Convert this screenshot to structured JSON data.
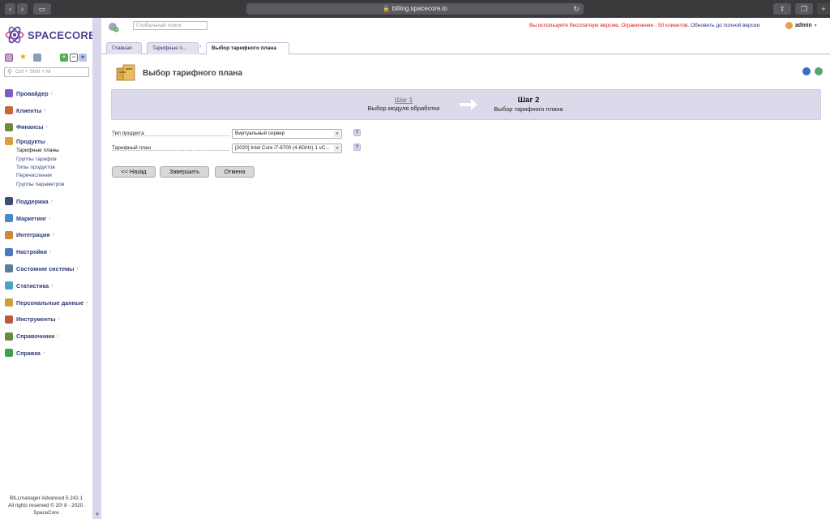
{
  "browser": {
    "url": "billing.spacecore.io"
  },
  "brand": {
    "name": "SPACECORE"
  },
  "sidebar": {
    "search_placeholder": "Ctrl + Shift + M",
    "menu": [
      {
        "label": "Провайдер",
        "icon": "provider-icon",
        "color": "#7a5cc9"
      },
      {
        "label": "Клиенты",
        "icon": "clients-icon",
        "color": "#c9643d"
      },
      {
        "label": "Финансы",
        "icon": "finance-icon",
        "color": "#6f8b3a"
      },
      {
        "label": "Продукты",
        "icon": "products-icon",
        "color": "#d9a03b",
        "sub": [
          "Тарифные планы",
          "Группы тарифов",
          "Типы продуктов",
          "Перечисления",
          "Группы параметров"
        ]
      },
      {
        "label": "Поддержка",
        "icon": "support-icon",
        "color": "#3f4b7d"
      },
      {
        "label": "Маркетинг",
        "icon": "marketing-icon",
        "color": "#4a8ac9"
      },
      {
        "label": "Интеграция",
        "icon": "integration-icon",
        "color": "#c98a3d"
      },
      {
        "label": "Настройки",
        "icon": "settings-icon",
        "color": "#4a7abf"
      },
      {
        "label": "Состояние системы",
        "icon": "system-state-icon",
        "color": "#5a7d9a"
      },
      {
        "label": "Статистика",
        "icon": "statistics-icon",
        "color": "#4aa3c9"
      },
      {
        "label": "Персональные данные",
        "icon": "personal-data-icon",
        "color": "#c9a23d"
      },
      {
        "label": "Инструменты",
        "icon": "tools-icon",
        "color": "#b85a3d"
      },
      {
        "label": "Справочники",
        "icon": "references-icon",
        "color": "#6a8a3d"
      },
      {
        "label": "Справка",
        "icon": "help-icon",
        "color": "#3da34a"
      }
    ],
    "footer": [
      "BILLmanager Advanced 5.242.1",
      "All rights reserved © 20! 8 - 2020.",
      "SpaceCore"
    ]
  },
  "top": {
    "search_placeholder": "Глобальный поиск",
    "warning": "Вы используете бесплатную версию. Ограничение - 50 клиентов.",
    "upgrade_link": "Обновить до полной версии",
    "user": "admin"
  },
  "tabs": [
    {
      "label": "Главная"
    },
    {
      "label": "Тарифные п..."
    },
    {
      "label": "Выбор тарифного плана"
    }
  ],
  "page": {
    "title": "Выбор тарифного плана",
    "step1_title": "Шаг 1",
    "step1_sub": "Выбор модуля обработки",
    "step2_title": "Шаг 2",
    "step2_sub": "Выбор тарифного плана",
    "product_type_label": "Тип продукта",
    "product_type_value": "Виртуальный сервер",
    "plan_label": "Тарифный план",
    "plan_value": "[2020] Intel Core i7-8700 (4.6GHz) 1 vC...",
    "back_btn": "<< Назад",
    "finish_btn": "Завершить",
    "cancel_btn": "Отмена"
  }
}
